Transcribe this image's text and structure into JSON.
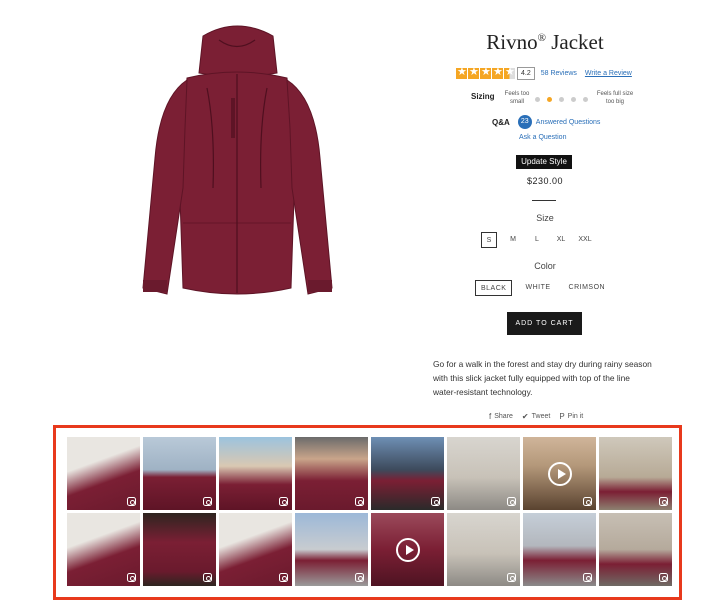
{
  "product": {
    "title": "Rivno",
    "title_mark": "®",
    "title_suffix": "Jacket",
    "rating_value": "4.2",
    "reviews_link": "58 Reviews",
    "write_review": "Write a Review",
    "sizing_label": "Sizing",
    "sizing_small": "Feels too small",
    "sizing_big": "Feels full size too big",
    "sizing_level": 0.35,
    "qa_label": "Q&A",
    "qa_count": "23",
    "answered_link": "Answered Questions",
    "ask_link": "Ask a Question",
    "update_style": "Update Style",
    "price": "$230.00",
    "size_label": "Size",
    "sizes": [
      "S",
      "M",
      "L",
      "XL",
      "XXL"
    ],
    "selected_size": "S",
    "color_label": "Color",
    "colors": [
      "BLACK",
      "WHITE",
      "CRIMSON"
    ],
    "selected_color": "BLACK",
    "add_to_cart": "ADD TO CART",
    "description": "Go for a walk in the forest and stay dry during rainy season with this slick jacket fully equipped with top of the line water-resistant technology.",
    "share": [
      {
        "icon": "facebook-icon",
        "label": "Share"
      },
      {
        "icon": "twitter-icon",
        "label": "Tweet"
      },
      {
        "icon": "pinterest-icon",
        "label": "Pin it"
      }
    ]
  },
  "colors": {
    "accent_star": "#f5a623",
    "link": "#2a6fb8",
    "jacket": "#7b1f34",
    "gallery_border": "#e8391c"
  }
}
